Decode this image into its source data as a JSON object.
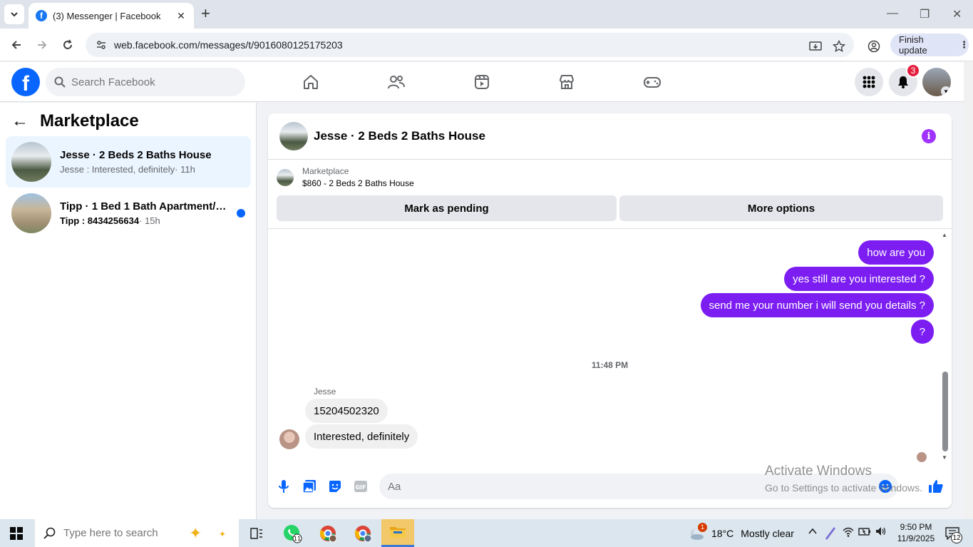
{
  "browser": {
    "tab_title": "(3) Messenger | Facebook",
    "url": "web.facebook.com/messages/t/9016080125175203",
    "finish_update_label": "Finish update"
  },
  "fb_header": {
    "search_placeholder": "Search Facebook",
    "notification_count": "3"
  },
  "sidebar": {
    "title": "Marketplace",
    "conversations": [
      {
        "name": "Jesse · 2 Beds 2 Baths House",
        "preview": "Jesse : Interested, definitely",
        "time": "· 11h",
        "active": true
      },
      {
        "name": "Tipp · 1 Bed 1 Bath Apartment/co...",
        "preview": "Tipp : 8434256634",
        "time": "· 15h",
        "unread": true
      }
    ]
  },
  "chat": {
    "title": "Jesse · 2 Beds 2 Baths House",
    "listing_label": "Marketplace",
    "listing_detail": "$860 - 2 Beds 2 Baths House",
    "mark_pending_label": "Mark as pending",
    "more_options_label": "More options",
    "outgoing": [
      "how are you",
      "yes still are you interested ?",
      "send me your number i will send you details ?",
      "?"
    ],
    "time_separator": "11:48 PM",
    "sender_name": "Jesse",
    "incoming": [
      "15204502320",
      "Interested, definitely"
    ],
    "composer_placeholder": "Aa"
  },
  "watermark": {
    "line1": "Activate Windows",
    "line2": "Go to Settings to activate Windows."
  },
  "taskbar": {
    "search_placeholder": "Type here to search",
    "whatsapp_count": "11",
    "weather_temp": "18°C",
    "weather_desc": "Mostly clear",
    "weather_alert": "1",
    "time": "9:50 PM",
    "date": "11/9/2025",
    "notification_count": "12"
  },
  "colors": {
    "fb_blue": "#0866ff",
    "bubble_purple": "#7c1df2",
    "badge_red": "#e41e3f"
  }
}
